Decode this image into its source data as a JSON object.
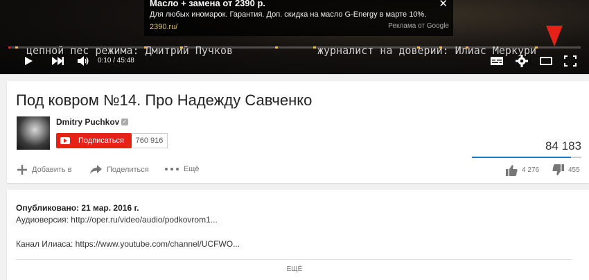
{
  "ad": {
    "title": "Масло + замена от 2390 р.",
    "description": "Для любых иномарок. Гарантия. Доп. скидка на масло G-Energy в марте 10%.",
    "url": "2390.ru/",
    "by": "Реклама от Google",
    "close_icon": "close-icon"
  },
  "player": {
    "subtitle_left": "цепной пес режима: Дмитрий Пучков",
    "subtitle_right": "журналист на доверии: Илиас Меркури",
    "time": "0:10 / 45:48",
    "progress_fraction": 0.0036,
    "colors": {
      "progress": "#e62117",
      "ad_marker": "#f1c232"
    }
  },
  "video": {
    "title": "Под ковром №14. Про Надежду Савченко",
    "channel_name": "Dmitry Puchkov",
    "subscribe_label": "Подписаться",
    "subscriber_count": "760 916",
    "views": "84 183",
    "actions": {
      "add_to": "Добавить в",
      "share": "Поделиться",
      "more": "Ещё"
    },
    "likes": "4 276",
    "dislikes": "455",
    "like_fraction": 0.903
  },
  "description": {
    "published": "Опубликовано: 21 мар. 2016 г.",
    "audio": "Аудиоверсия: http://oper.ru/video/audio/podkovrom1...",
    "channel": "Канал Илиаса: https://www.youtube.com/channel/UCFWO...",
    "more_label": "ЕЩЁ"
  }
}
